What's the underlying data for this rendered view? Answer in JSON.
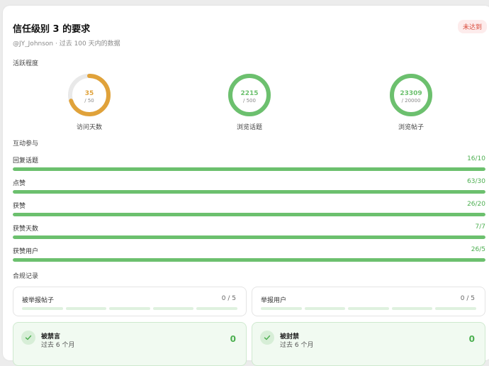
{
  "header": {
    "title": "信任级别 3 的要求",
    "badge": "未达到",
    "subtitle": "@JY_Johnson · 过去 100 天内的数据"
  },
  "activity": {
    "label": "活跃程度",
    "gauges": [
      {
        "value": "35",
        "max": "/ 50",
        "caption": "访问天数",
        "fraction": 0.7,
        "color": "#e0a23a"
      },
      {
        "value": "2215",
        "max": "/ 500",
        "caption": "浏览话题",
        "fraction": 1.0,
        "color": "#6cc06e"
      },
      {
        "value": "23309",
        "max": "/ 20000",
        "caption": "浏览帖子",
        "fraction": 1.0,
        "color": "#6cc06e"
      }
    ]
  },
  "interaction": {
    "label": "互动参与",
    "rows": [
      {
        "label": "回复话题",
        "value": "16/10",
        "fraction": 1.0
      },
      {
        "label": "点赞",
        "value": "63/30",
        "fraction": 1.0
      },
      {
        "label": "获赞",
        "value": "26/20",
        "fraction": 1.0
      },
      {
        "label": "获赞天数",
        "value": "7/7",
        "fraction": 1.0
      },
      {
        "label": "获赞用户",
        "value": "26/5",
        "fraction": 1.0
      }
    ]
  },
  "compliance": {
    "label": "合规记录",
    "reports": [
      {
        "label": "被举报帖子",
        "value": "0 / 5"
      },
      {
        "label": "举报用户",
        "value": "0 / 5"
      }
    ],
    "statuses": [
      {
        "title": "被禁言",
        "sub": "过去 6 个月",
        "value": "0"
      },
      {
        "title": "被封禁",
        "sub": "过去 6 个月",
        "value": "0"
      }
    ]
  },
  "colors": {
    "accent_green": "#6cc06e",
    "accent_orange": "#e0a23a",
    "badge_red": "#d94b3b"
  }
}
